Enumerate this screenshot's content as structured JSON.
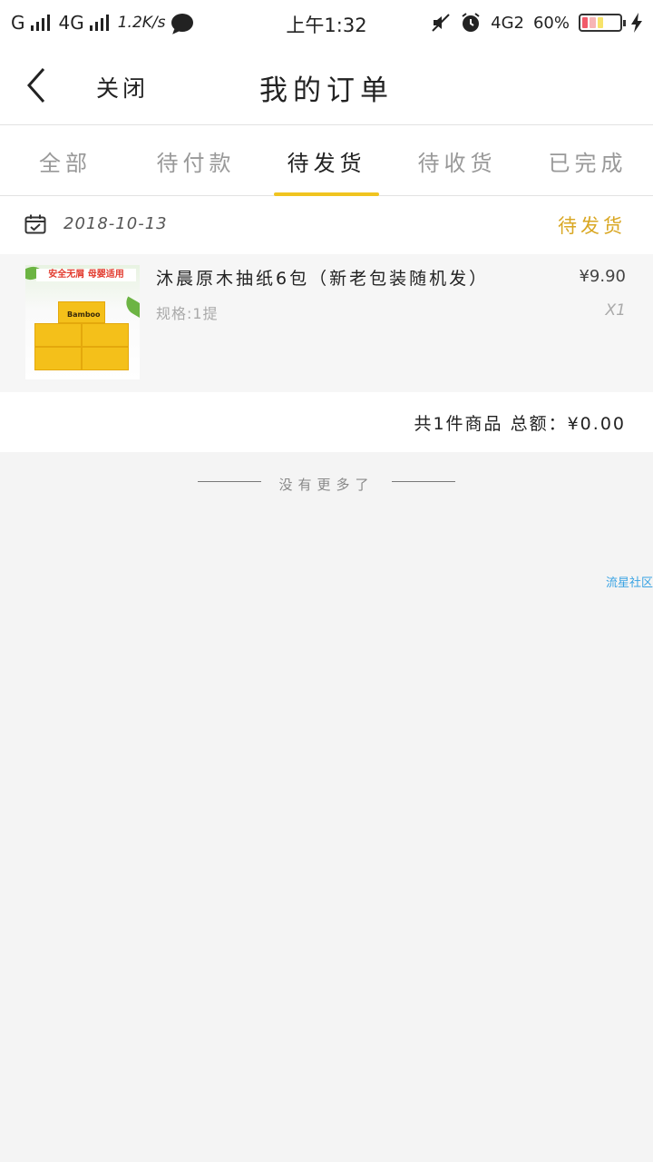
{
  "status_bar": {
    "carrier1": "G",
    "carrier2": "4G",
    "speed": "1.2K/s",
    "time": "上午1:32",
    "network": "4G2",
    "battery": "60%"
  },
  "header": {
    "close_label": "关闭",
    "title": "我的订单",
    "back_icon": "chevron-left-icon"
  },
  "tabs": [
    {
      "label": "全部",
      "active": false
    },
    {
      "label": "待付款",
      "active": false
    },
    {
      "label": "待发货",
      "active": true
    },
    {
      "label": "待收货",
      "active": false
    },
    {
      "label": "已完成",
      "active": false
    }
  ],
  "order": {
    "date": "2018-10-13",
    "status": "待发货",
    "item": {
      "name": "沐晨原木抽纸6包（新老包装随机发）",
      "spec": "规格:1提",
      "price": "¥9.90",
      "qty": "X1",
      "image_banner": "安全无屑 母婴适用",
      "image_brand": "Bamboo"
    },
    "summary": "共1件商品 总额：¥0.00"
  },
  "end_text": "没有更多了",
  "watermark": "流星社区",
  "colors": {
    "accent": "#f0c420",
    "status_text": "#d9a723",
    "background": "#f4f4f4"
  }
}
